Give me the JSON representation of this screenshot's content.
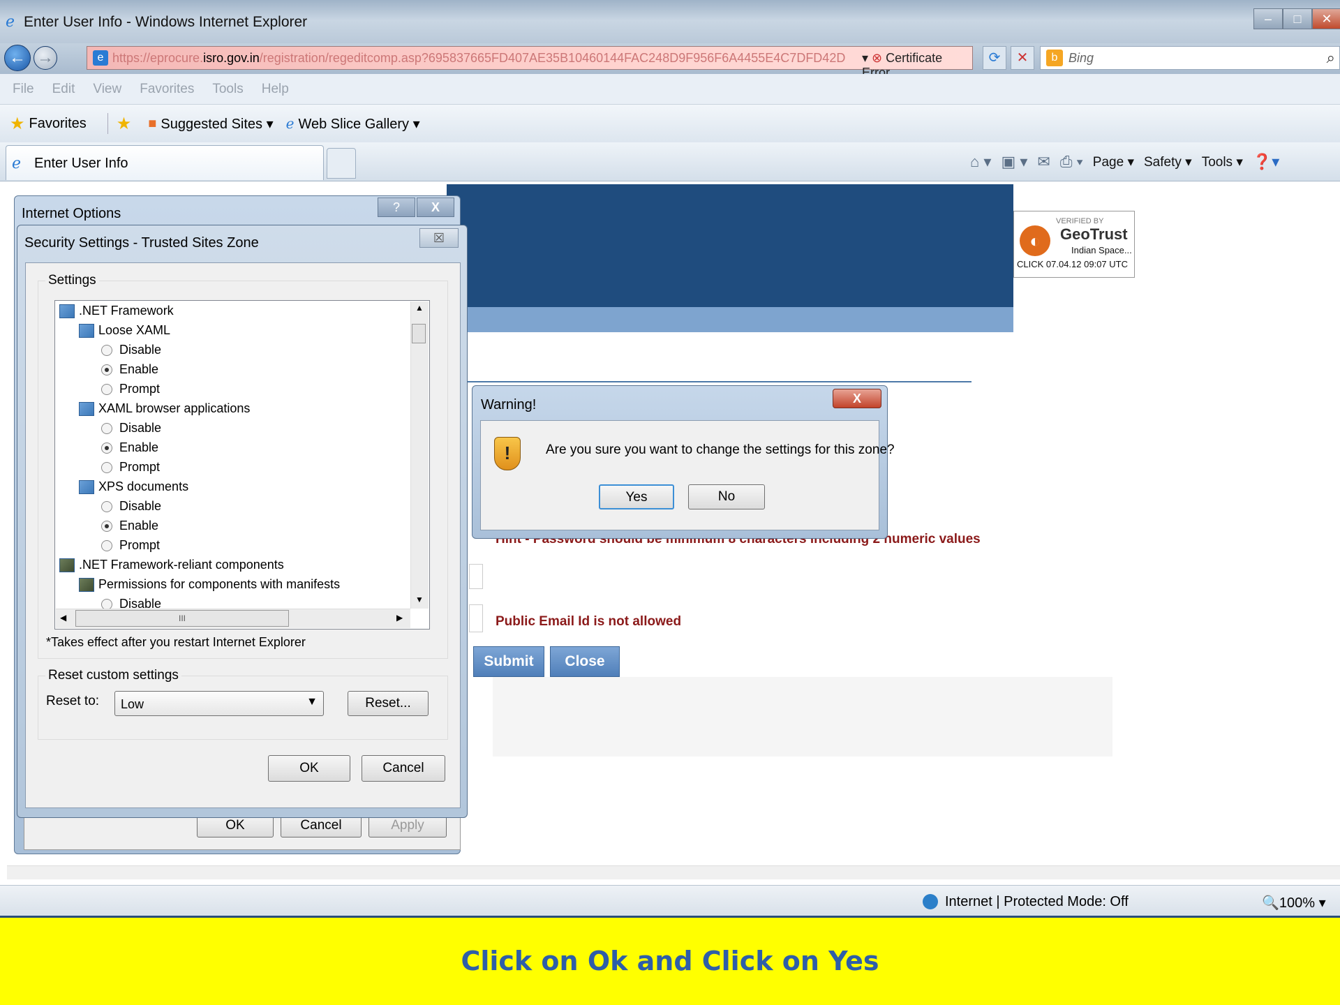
{
  "browser": {
    "title": "Enter User Info - Windows Internet Explorer",
    "url_prefix": "https://eprocure.",
    "url_domain": "isro.gov.in",
    "url_rest": "/registration/regeditcomp.asp?695837665FD407AE35B10460144FAC248D9F956F6A4455E4C7DFD42D",
    "certificate_error": "Certificate Error",
    "search_placeholder": "Bing",
    "menu": [
      "File",
      "Edit",
      "View",
      "Favorites",
      "Tools",
      "Help"
    ],
    "favorites_label": "Favorites",
    "suggested_sites": "Suggested Sites ▾",
    "web_slice_gallery": "Web Slice Gallery ▾",
    "tab_label": "Enter User Info",
    "cmd": {
      "page": "Page ▾",
      "safety": "Safety ▾",
      "tools": "Tools ▾"
    },
    "status_zone": "Internet | Protected Mode: Off",
    "zoom": "100%"
  },
  "page": {
    "geotrust": {
      "verified": "VERIFIED BY",
      "brand": "GeoTrust",
      "sub": "Indian Space...",
      "click": "CLICK 07.04.12 09:07 UTC"
    },
    "hint": "Hint - Password should be minimum 8 characters including 2 numeric values",
    "public_email": "Public Email Id is not allowed",
    "submit": "Submit",
    "close": "Close"
  },
  "internet_options": {
    "title": "Internet Options",
    "help": "?",
    "close": "X",
    "ok": "OK",
    "cancel": "Cancel",
    "apply": "Apply"
  },
  "security_settings": {
    "title": "Security Settings - Trusted Sites Zone",
    "settings_label": "Settings",
    "tree": [
      {
        "label": ".NET Framework",
        "kind": "icon"
      },
      {
        "label": "Loose XAML",
        "kind": "icon"
      },
      {
        "label": "Disable",
        "kind": "radio",
        "checked": false
      },
      {
        "label": "Enable",
        "kind": "radio",
        "checked": true
      },
      {
        "label": "Prompt",
        "kind": "radio",
        "checked": false
      },
      {
        "label": "XAML browser applications",
        "kind": "icon"
      },
      {
        "label": "Disable",
        "kind": "radio",
        "checked": false
      },
      {
        "label": "Enable",
        "kind": "radio",
        "checked": true
      },
      {
        "label": "Prompt",
        "kind": "radio",
        "checked": false
      },
      {
        "label": "XPS documents",
        "kind": "icon"
      },
      {
        "label": "Disable",
        "kind": "radio",
        "checked": false
      },
      {
        "label": "Enable",
        "kind": "radio",
        "checked": true
      },
      {
        "label": "Prompt",
        "kind": "radio",
        "checked": false
      },
      {
        "label": ".NET Framework-reliant components",
        "kind": "icon-dark"
      },
      {
        "label": "Permissions for components with manifests",
        "kind": "icon-dark"
      },
      {
        "label": "Disable",
        "kind": "radio",
        "checked": false
      }
    ],
    "restart_note": "*Takes effect after you restart Internet Explorer",
    "reset_group": "Reset custom settings",
    "reset_to": "Reset to:",
    "reset_value": "Low",
    "reset_button": "Reset...",
    "ok": "OK",
    "cancel": "Cancel"
  },
  "warning": {
    "title": "Warning!",
    "message": "Are you sure you want to change the settings for this zone?",
    "yes": "Yes",
    "no": "No"
  },
  "caption": "Click on Ok and Click on Yes"
}
